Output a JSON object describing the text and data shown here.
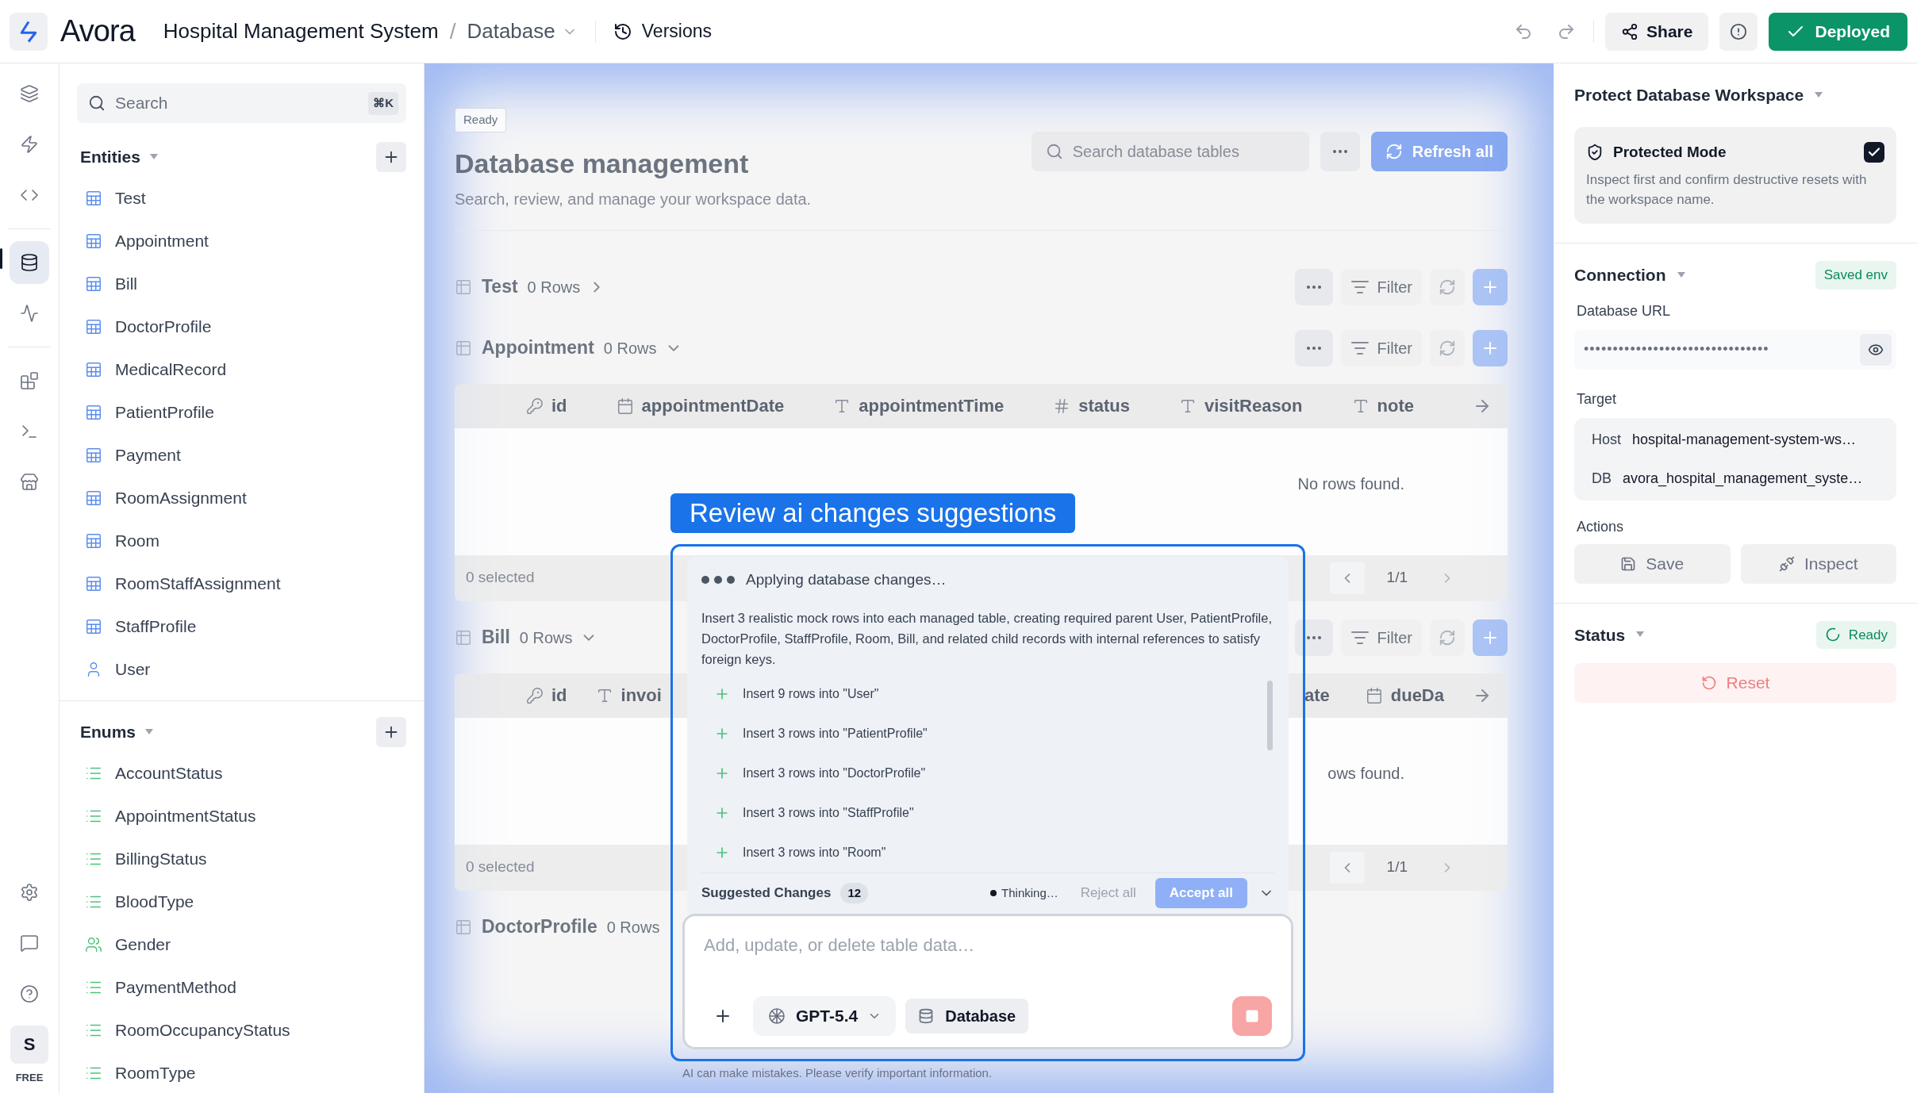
{
  "app": {
    "name": "Avora"
  },
  "breadcrumb": {
    "project": "Hospital Management System",
    "separator": "/",
    "page": "Database"
  },
  "versions": "Versions",
  "toolbar": {
    "share": "Share",
    "deploy": {
      "label": "Deployed",
      "deployed": true
    }
  },
  "rail": {
    "top": [
      {
        "kind": "layers",
        "selected": false
      },
      {
        "kind": "bolt",
        "selected": false
      },
      {
        "kind": "code",
        "selected": false
      },
      {
        "kind": "divider"
      },
      {
        "kind": "database",
        "selected": true
      },
      {
        "kind": "activity",
        "selected": false
      },
      {
        "kind": "divider"
      },
      {
        "kind": "blocks",
        "selected": false
      },
      {
        "kind": "terminal",
        "selected": false
      },
      {
        "kind": "store",
        "selected": false
      }
    ],
    "bottom": [
      {
        "kind": "settings",
        "selected": false
      },
      {
        "kind": "message",
        "selected": false
      },
      {
        "kind": "help",
        "selected": false
      }
    ],
    "avatar": "S",
    "plan": "FREE"
  },
  "sidebar": {
    "search": {
      "placeholder": "Search",
      "shortcut": "⌘K"
    },
    "sections": [
      {
        "title": "Entities",
        "items": [
          {
            "label": "Test",
            "kind": "table"
          },
          {
            "label": "Appointment",
            "kind": "table"
          },
          {
            "label": "Bill",
            "kind": "table"
          },
          {
            "label": "DoctorProfile",
            "kind": "table"
          },
          {
            "label": "MedicalRecord",
            "kind": "table"
          },
          {
            "label": "PatientProfile",
            "kind": "table"
          },
          {
            "label": "Payment",
            "kind": "table"
          },
          {
            "label": "RoomAssignment",
            "kind": "table"
          },
          {
            "label": "Room",
            "kind": "table"
          },
          {
            "label": "RoomStaffAssignment",
            "kind": "table"
          },
          {
            "label": "StaffProfile",
            "kind": "table"
          },
          {
            "label": "User",
            "kind": "user"
          }
        ]
      },
      {
        "title": "Enums",
        "items": [
          {
            "label": "AccountStatus",
            "kind": "enum"
          },
          {
            "label": "AppointmentStatus",
            "kind": "enum"
          },
          {
            "label": "BillingStatus",
            "kind": "enum"
          },
          {
            "label": "BloodType",
            "kind": "enum"
          },
          {
            "label": "Gender",
            "kind": "people"
          },
          {
            "label": "PaymentMethod",
            "kind": "enum"
          },
          {
            "label": "RoomOccupancyStatus",
            "kind": "enum"
          },
          {
            "label": "RoomType",
            "kind": "enum"
          }
        ]
      }
    ]
  },
  "workspace": {
    "status": "Ready",
    "title": "Database management",
    "subtitle": "Search, review, and manage your workspace data.",
    "search_placeholder": "Search database tables",
    "refresh": "Refresh all",
    "tables": [
      {
        "name": "Test",
        "rows": "0 Rows",
        "expanded": false,
        "filter": "Filter"
      },
      {
        "name": "Appointment",
        "rows": "0 Rows",
        "expanded": true,
        "filter": "Filter",
        "columns": [
          {
            "name": "id",
            "kind": "key"
          },
          {
            "name": "appointmentDate",
            "kind": "date"
          },
          {
            "name": "appointmentTime",
            "kind": "text"
          },
          {
            "name": "status",
            "kind": "number"
          },
          {
            "name": "visitReason",
            "kind": "text"
          },
          {
            "name": "note",
            "kind": "text"
          }
        ],
        "empty": "No rows found.",
        "selection": "0 selected",
        "page": "1/1"
      },
      {
        "name": "Bill",
        "rows": "0 Rows",
        "expanded": true,
        "filter": "Filter",
        "columns": [
          {
            "name": "id",
            "kind": "key"
          },
          {
            "name": "invoi",
            "kind": "text"
          }
        ],
        "columns_right": [
          {
            "name": "ate",
            "kind": "none"
          },
          {
            "name": "dueDa",
            "kind": "date"
          }
        ],
        "empty": "ows found.",
        "selection": "0 selected",
        "page": "1/1"
      },
      {
        "name": "DoctorProfile",
        "rows": "0 Rows"
      }
    ]
  },
  "review_label": "Review ai changes suggestions",
  "assistant": {
    "status": "Applying database changes…",
    "message": "Insert 3 realistic mock rows into each managed table, creating required parent User, PatientProfile, DoctorProfile, StaffProfile, Room, Bill, and related child records with internal references to satisfy foreign keys.",
    "changes": [
      "Insert 9 rows into \"User\"",
      "Insert 3 rows into \"PatientProfile\"",
      "Insert 3 rows into \"DoctorProfile\"",
      "Insert 3 rows into \"StaffProfile\"",
      "Insert 3 rows into \"Room\""
    ],
    "summary": {
      "label": "Suggested Changes",
      "count": "12",
      "thinking": "Thinking…",
      "reject": "Reject all",
      "accept": "Accept all"
    },
    "composer": {
      "placeholder": "Add, update, or delete table data…",
      "model": "GPT-5.4",
      "context": "Database"
    },
    "disclaimer": "AI can make mistakes. Please verify important information."
  },
  "protect": {
    "title": "Protect Database Workspace",
    "mode": {
      "label": "Protected Mode",
      "description": "Inspect first and confirm destructive resets with the workspace name.",
      "checked": true
    }
  },
  "connection": {
    "title": "Connection",
    "badge": "Saved env",
    "url_label": "Database URL",
    "url_value": "••••••••••••••••••••••••••••••••",
    "target_label": "Target",
    "target": [
      {
        "key": "Host",
        "value": "hospital-management-system-ws…"
      },
      {
        "key": "DB",
        "value": "avora_hospital_management_syste…"
      }
    ],
    "actions_label": "Actions",
    "actions": [
      {
        "label": "Save",
        "kind": "save"
      },
      {
        "label": "Inspect",
        "kind": "plug"
      }
    ]
  },
  "status": {
    "title": "Status",
    "badge": "Ready",
    "reset": "Reset"
  }
}
